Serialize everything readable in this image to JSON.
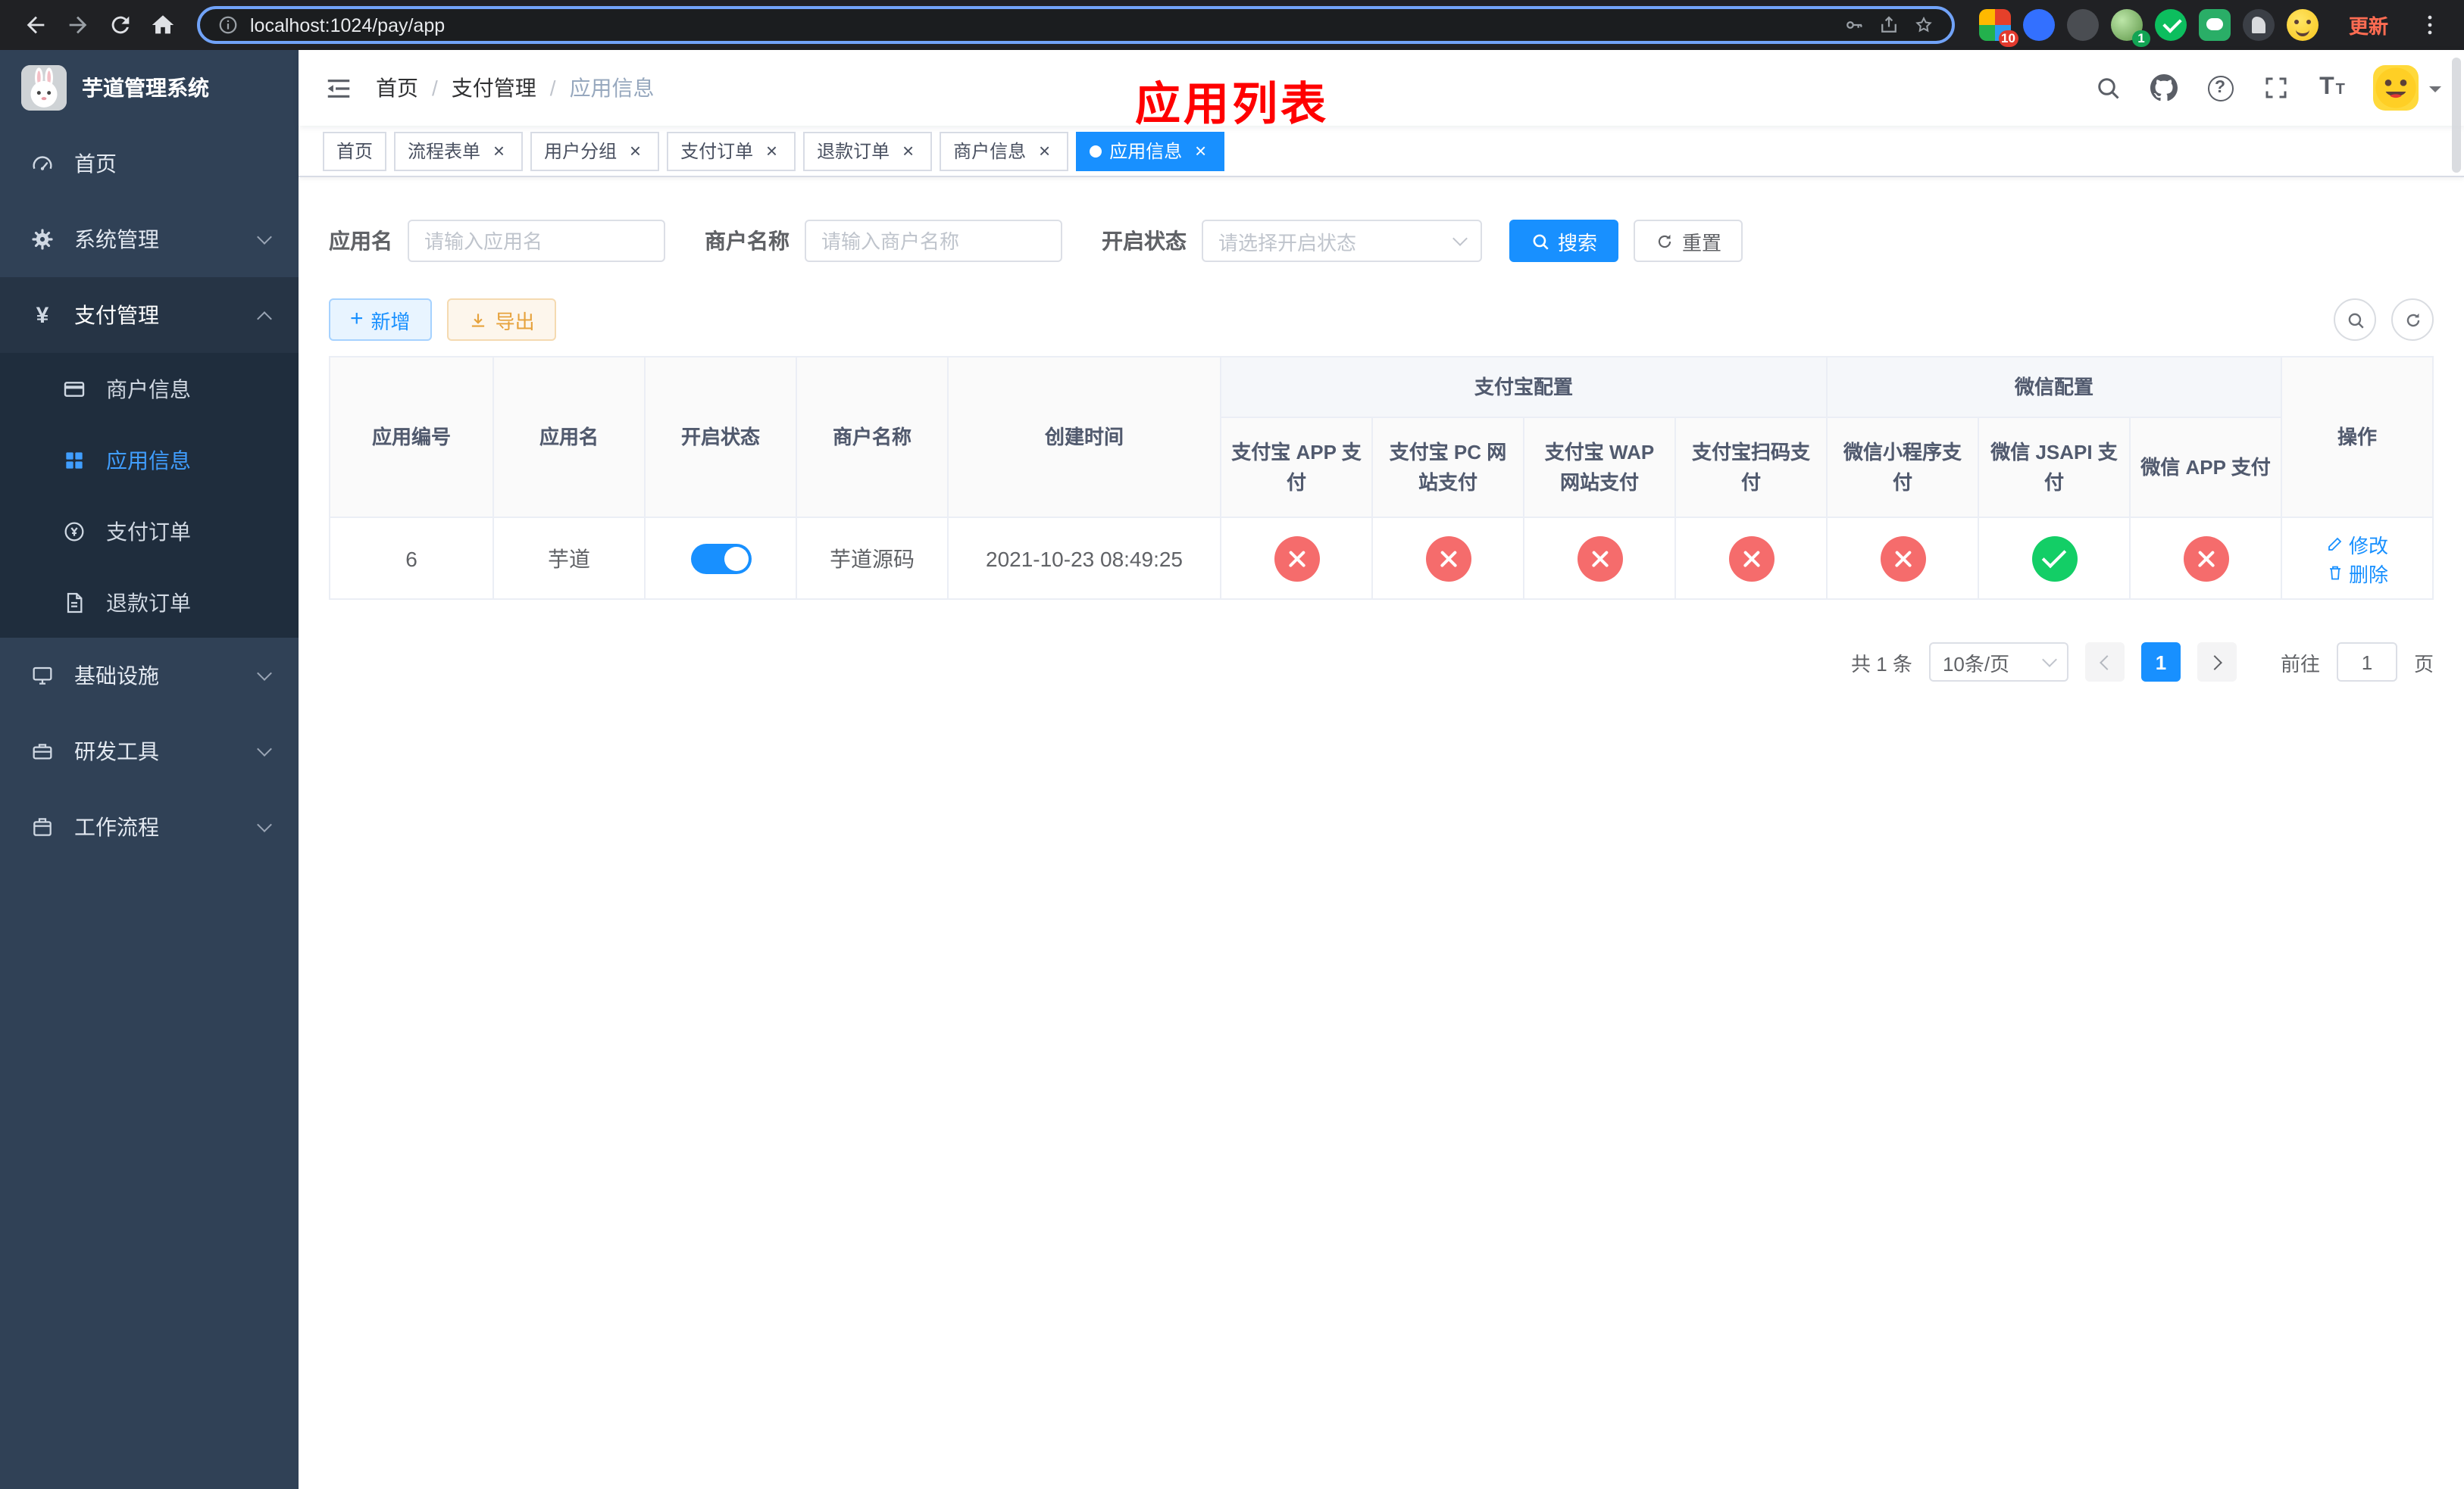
{
  "browser": {
    "url": "localhost:1024/pay/app",
    "update_label": "更新",
    "ext_badge_red": "10",
    "ext_badge_green": "1"
  },
  "sidebar": {
    "title": "芋道管理系统",
    "items": [
      {
        "label": "首页"
      },
      {
        "label": "系统管理"
      },
      {
        "label": "支付管理",
        "children": [
          {
            "label": "商户信息"
          },
          {
            "label": "应用信息"
          },
          {
            "label": "支付订单"
          },
          {
            "label": "退款订单"
          }
        ]
      },
      {
        "label": "基础设施"
      },
      {
        "label": "研发工具"
      },
      {
        "label": "工作流程"
      }
    ]
  },
  "header": {
    "breadcrumb": [
      "首页",
      "支付管理",
      "应用信息"
    ],
    "overlay_title": "应用列表"
  },
  "tabs": [
    {
      "label": "首页"
    },
    {
      "label": "流程表单"
    },
    {
      "label": "用户分组"
    },
    {
      "label": "支付订单"
    },
    {
      "label": "退款订单"
    },
    {
      "label": "商户信息"
    },
    {
      "label": "应用信息"
    }
  ],
  "filters": {
    "app_name_label": "应用名",
    "app_name_placeholder": "请输入应用名",
    "merchant_label": "商户名称",
    "merchant_placeholder": "请输入商户名称",
    "status_label": "开启状态",
    "status_placeholder": "请选择开启状态",
    "search_label": "搜索",
    "reset_label": "重置"
  },
  "toolbar": {
    "add_label": "新增",
    "export_label": "导出"
  },
  "table": {
    "group_alipay": "支付宝配置",
    "group_wechat": "微信配置",
    "columns": [
      "应用编号",
      "应用名",
      "开启状态",
      "商户名称",
      "创建时间",
      "支付宝 APP 支付",
      "支付宝 PC 网站支付",
      "支付宝 WAP 网站支付",
      "支付宝扫码支付",
      "微信小程序支付",
      "微信 JSAPI 支付",
      "微信 APP 支付",
      "操作"
    ],
    "row": {
      "id": "6",
      "name": "芋道",
      "enabled": "on",
      "merchant": "芋道源码",
      "created": "2021-10-23 08:49:25",
      "statuses": [
        "err",
        "err",
        "err",
        "err",
        "err",
        "ok",
        "err"
      ],
      "edit_label": "修改",
      "delete_label": "删除"
    }
  },
  "pagination": {
    "total": "共 1 条",
    "page_size": "10条/页",
    "current": "1",
    "goto_label": "前往",
    "unit_label": "页",
    "goto_value": "1"
  },
  "colors": {
    "primary": "#1890ff",
    "sidebar_active": "#409eff",
    "danger": "#f56c6c",
    "success": "#13ce66",
    "warning": "#e6a23c",
    "annotation": "#ff0000",
    "sidebar_bg": "#304156",
    "sidebar_sub_bg": "#1f2d3d"
  }
}
